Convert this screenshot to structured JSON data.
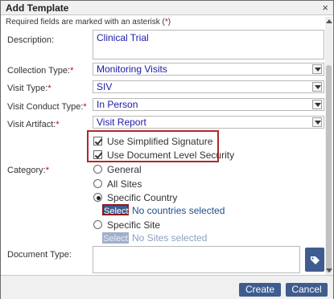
{
  "dialog": {
    "title": "Add Template",
    "close_glyph": "×",
    "required_note_prefix": "Required fields are marked with an asterisk (",
    "required_note_asterisk": "*",
    "required_note_suffix": ")"
  },
  "fields": {
    "description": {
      "label": "Description:",
      "value": "Clinical Trial"
    },
    "collection_type": {
      "label": "Collection Type:",
      "value": "Monitoring Visits"
    },
    "visit_type": {
      "label": "Visit Type:",
      "value": "SIV"
    },
    "visit_conduct_type": {
      "label": "Visit Conduct Type:",
      "value": "In Person"
    },
    "visit_artifact": {
      "label": "Visit Artifact:",
      "value": "Visit Report"
    },
    "category_label": "Category:",
    "document_type_label": "Document Type:",
    "asterisk": "*"
  },
  "checkboxes": {
    "simplified_signature": "Use Simplified Signature",
    "document_level_security": "Use Document Level Security"
  },
  "category": {
    "general": "General",
    "all_sites": "All Sites",
    "specific_country": "Specific Country",
    "specific_country_select": "Select",
    "specific_country_selected": "No countries selected",
    "specific_site": "Specific Site",
    "specific_site_select": "Select",
    "specific_site_selected": "No Sites selected"
  },
  "footer": {
    "create": "Create",
    "cancel": "Cancel"
  },
  "colors": {
    "accent": "#3f5c8f",
    "highlight": "#b0282c",
    "required": "#cc0000"
  }
}
